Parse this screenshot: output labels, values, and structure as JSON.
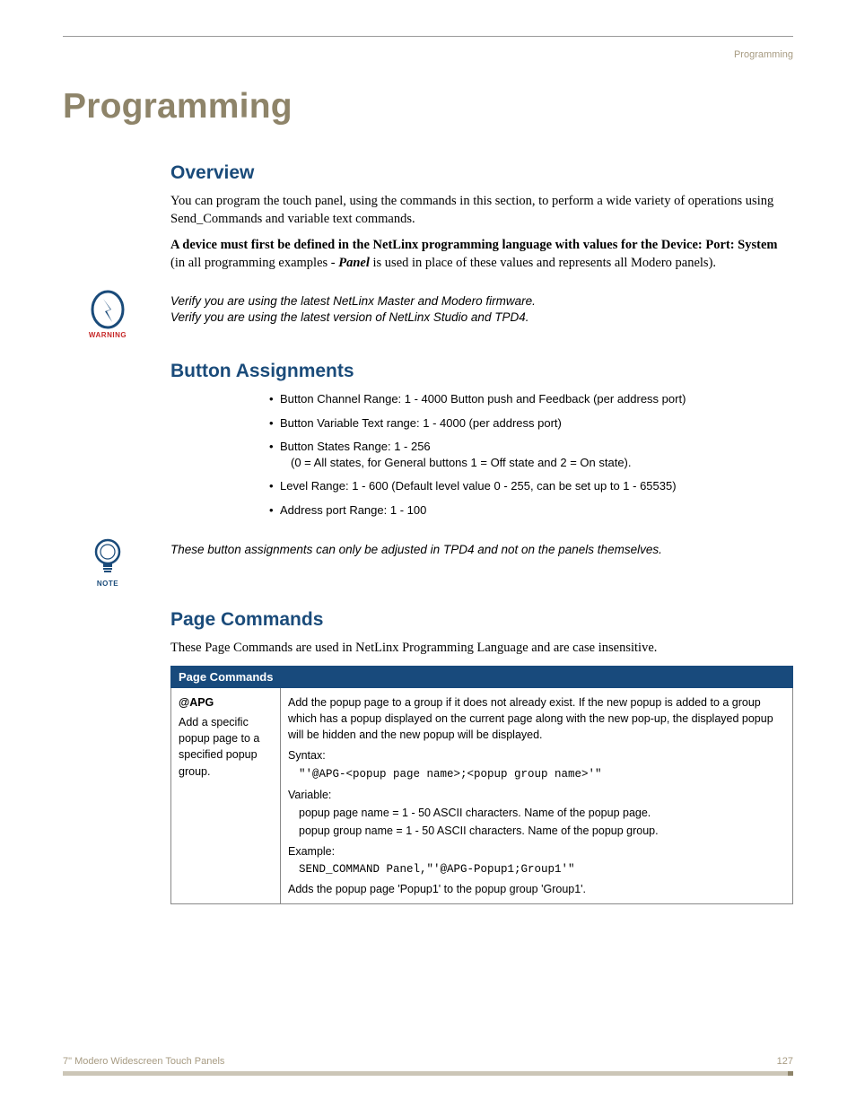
{
  "breadcrumb": "Programming",
  "page_title": "Programming",
  "overview": {
    "heading": "Overview",
    "p1": "You can program the touch panel, using the commands in this section, to perform a wide variety of operations using Send_Commands and variable text commands.",
    "p2a": "A device must first be defined in the NetLinx programming language with values for the Device: Port: System",
    "p2b": " (in all programming examples - ",
    "p2c": "Panel",
    "p2d": " is used in place of these values and represents all Modero panels)."
  },
  "warning": {
    "label": "WARNING",
    "line1": "Verify you are using the latest NetLinx Master and Modero firmware.",
    "line2": "Verify you are using the latest version of NetLinx Studio and TPD4."
  },
  "button_assignments": {
    "heading": "Button Assignments",
    "items": [
      "Button Channel Range: 1 - 4000 Button push and Feedback (per address port)",
      "Button Variable Text range: 1 - 4000 (per address port)",
      "Button States Range: 1 - 256",
      "Level Range: 1 - 600 (Default level value 0 - 255, can be set up to 1 - 65535)",
      "Address port Range: 1 - 100"
    ],
    "item3_sub": "(0 = All states, for General buttons 1 = Off state and 2 = On state)."
  },
  "note": {
    "label": "NOTE",
    "text": "These button assignments can only be adjusted in TPD4 and not on the panels themselves."
  },
  "page_commands": {
    "heading": "Page Commands",
    "intro": "These Page Commands are used in NetLinx Programming Language and are case insensitive.",
    "table_header": "Page Commands",
    "cmd_name": "@APG",
    "cmd_desc": "Add a specific popup page to a specified popup group.",
    "right_desc": "Add the popup page to a group if it does not already exist. If the new popup is added to a group which has a popup displayed on the current page along with the new pop-up, the displayed popup will be hidden and the new popup will be displayed.",
    "syntax_label": "Syntax:",
    "syntax": "\"'@APG-<popup page name>;<popup group name>'\"",
    "variable_label": "Variable:",
    "var1": "popup page name = 1 - 50 ASCII characters. Name of the popup page.",
    "var2": "popup group name = 1 - 50 ASCII characters. Name of the popup group.",
    "example_label": "Example:",
    "example": "SEND_COMMAND Panel,\"'@APG-Popup1;Group1'\"",
    "example_note": "Adds the popup page 'Popup1' to the popup group 'Group1'."
  },
  "footer": {
    "text": "7\" Modero Widescreen Touch Panels",
    "page": "127"
  }
}
